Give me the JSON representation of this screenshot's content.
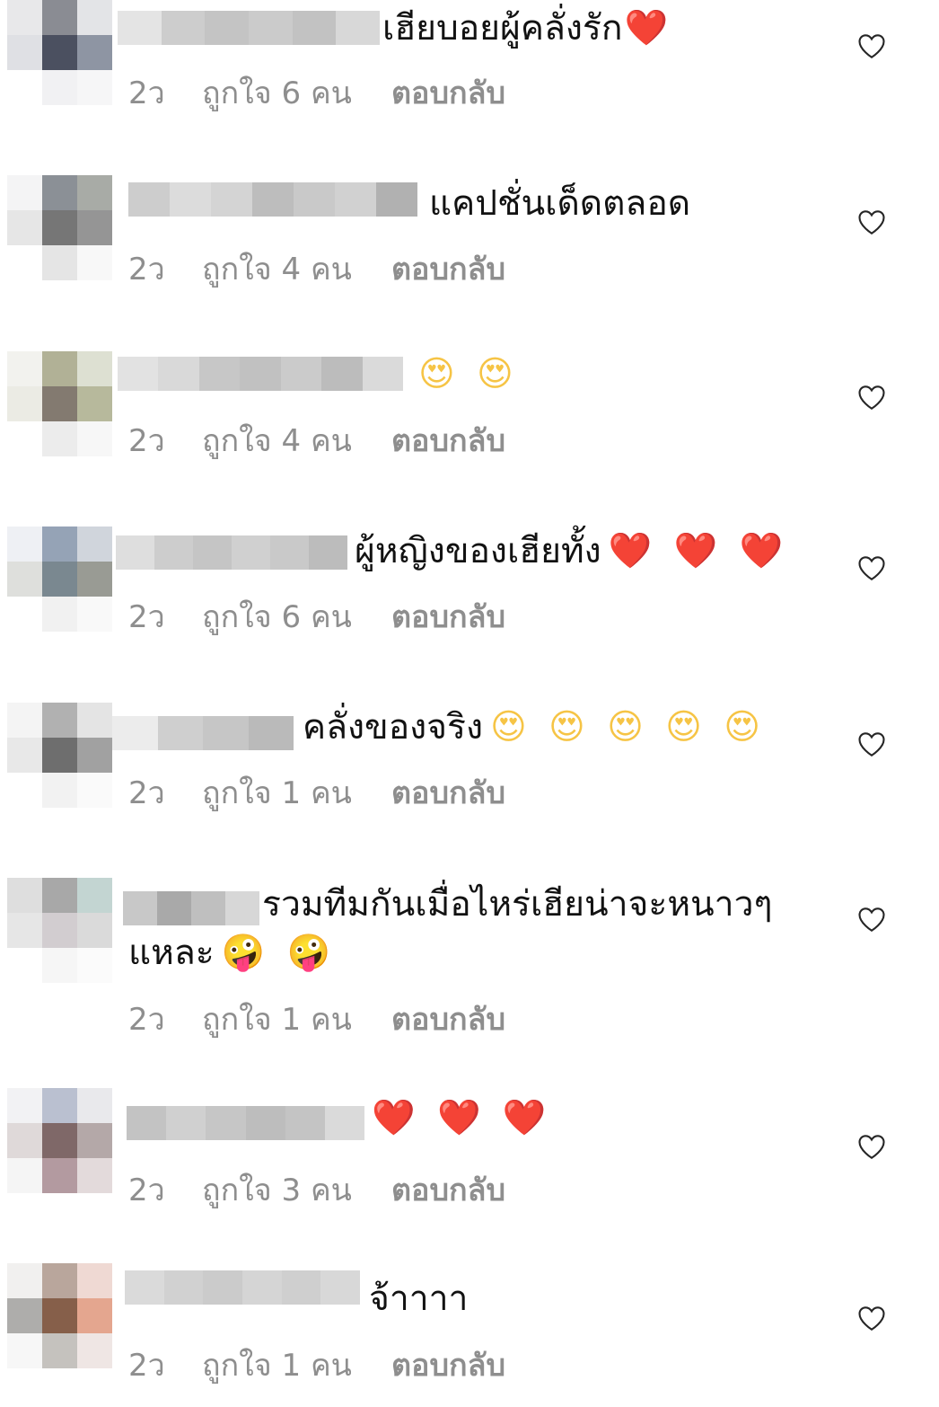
{
  "colors": {
    "text": "#121212",
    "meta": "#8e8e8e",
    "heart_emoji": "#e0263a",
    "face_emoji": "#f6c445",
    "like_outline": "#262626"
  },
  "comments": [
    {
      "text": "เฮียบอยผู้คลั่งรัก",
      "emoji": "❤️",
      "time": "2ว",
      "likes": "ถูกใจ 6 คน",
      "reply": "ตอบกลับ",
      "like_icon": "heart-outline-icon"
    },
    {
      "text": "แคปชั่นเด็ดตลอด",
      "emoji": "",
      "time": "2ว",
      "likes": "ถูกใจ 4 คน",
      "reply": "ตอบกลับ",
      "like_icon": "heart-outline-icon"
    },
    {
      "text": "",
      "emoji": "😍 😍",
      "time": "2ว",
      "likes": "ถูกใจ 4 คน",
      "reply": "ตอบกลับ",
      "like_icon": "heart-outline-icon"
    },
    {
      "text": "ผู้หญิงของเฮียทั้ง",
      "emoji": "❤️ ❤️ ❤️",
      "time": "2ว",
      "likes": "ถูกใจ 6 คน",
      "reply": "ตอบกลับ",
      "like_icon": "heart-outline-icon"
    },
    {
      "text": "คลั่งของจริง",
      "emoji": "😍 😍 😍 😍 😍",
      "time": "2ว",
      "likes": "ถูกใจ 1 คน",
      "reply": "ตอบกลับ",
      "like_icon": "heart-outline-icon"
    },
    {
      "text": "รวมทีมกันเมื่อไหร่เฮียน่าจะหนาวๆ",
      "text2": "แหละ",
      "emoji": "🤪 🤪",
      "time": "2ว",
      "likes": "ถูกใจ 1 คน",
      "reply": "ตอบกลับ",
      "like_icon": "heart-outline-icon"
    },
    {
      "text": "",
      "emoji": "❤️ ❤️ ❤️",
      "time": "2ว",
      "likes": "ถูกใจ 3 คน",
      "reply": "ตอบกลับ",
      "like_icon": "heart-outline-icon"
    },
    {
      "text": "จ้าาาา",
      "emoji": "",
      "time": "2ว",
      "likes": "ถูกใจ 1 คน",
      "reply": "ตอบกลับ",
      "like_icon": "heart-outline-icon"
    }
  ]
}
